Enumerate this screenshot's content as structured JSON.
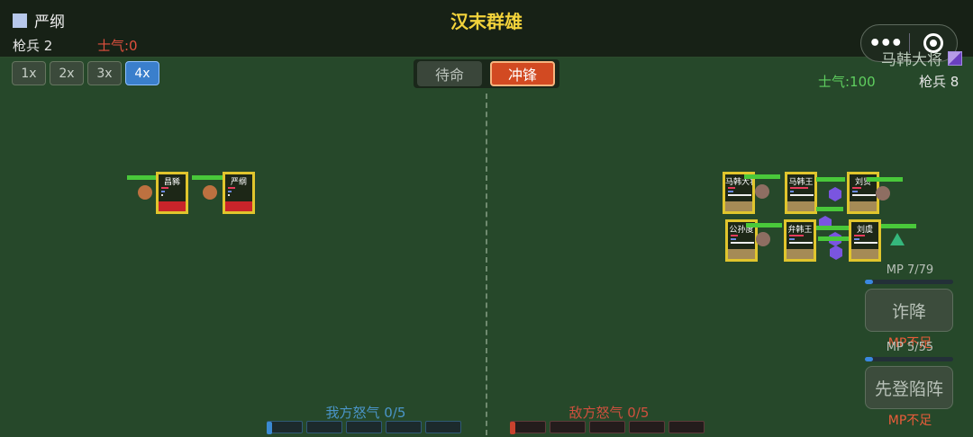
{
  "header": {
    "title": "汉末群雄",
    "player": {
      "name": "严纲",
      "troops": "枪兵 2",
      "morale": "士气:0",
      "color": "#b7c8ec"
    },
    "enemy": {
      "name": "马韩大将",
      "troops": "枪兵 8",
      "morale": "士气:100",
      "color": "#8a6ad6"
    }
  },
  "capsule": {
    "more_icon": "•••",
    "close_icon": "target-icon"
  },
  "speed": {
    "options": [
      "1x",
      "2x",
      "3x",
      "4x"
    ],
    "active": "4x"
  },
  "mode": {
    "standby": "待命",
    "charge": "冲锋",
    "active": "冲锋"
  },
  "units": {
    "player": [
      {
        "name": "昌豨"
      },
      {
        "name": "严纲"
      }
    ],
    "enemy": [
      {
        "name": "马韩大将"
      },
      {
        "name": "马韩王"
      },
      {
        "name": "刘贤"
      },
      {
        "name": "公孙度"
      },
      {
        "name": "弁韩王"
      },
      {
        "name": "刘虞"
      }
    ]
  },
  "skills": [
    {
      "mp_label": "MP 7/79",
      "mp_fraction": 0.09,
      "name": "诈降",
      "status": "MP不足"
    },
    {
      "mp_label": "MP 5/55",
      "mp_fraction": 0.09,
      "name": "先登陷阵",
      "status": "MP不足"
    }
  ],
  "rage": {
    "player": {
      "label": "我方怒气 0/5",
      "value": 0,
      "max": 5,
      "color": "#4a95c8"
    },
    "enemy": {
      "label": "敌方怒气 0/5",
      "value": 0,
      "max": 5,
      "color": "#d0503e"
    }
  }
}
